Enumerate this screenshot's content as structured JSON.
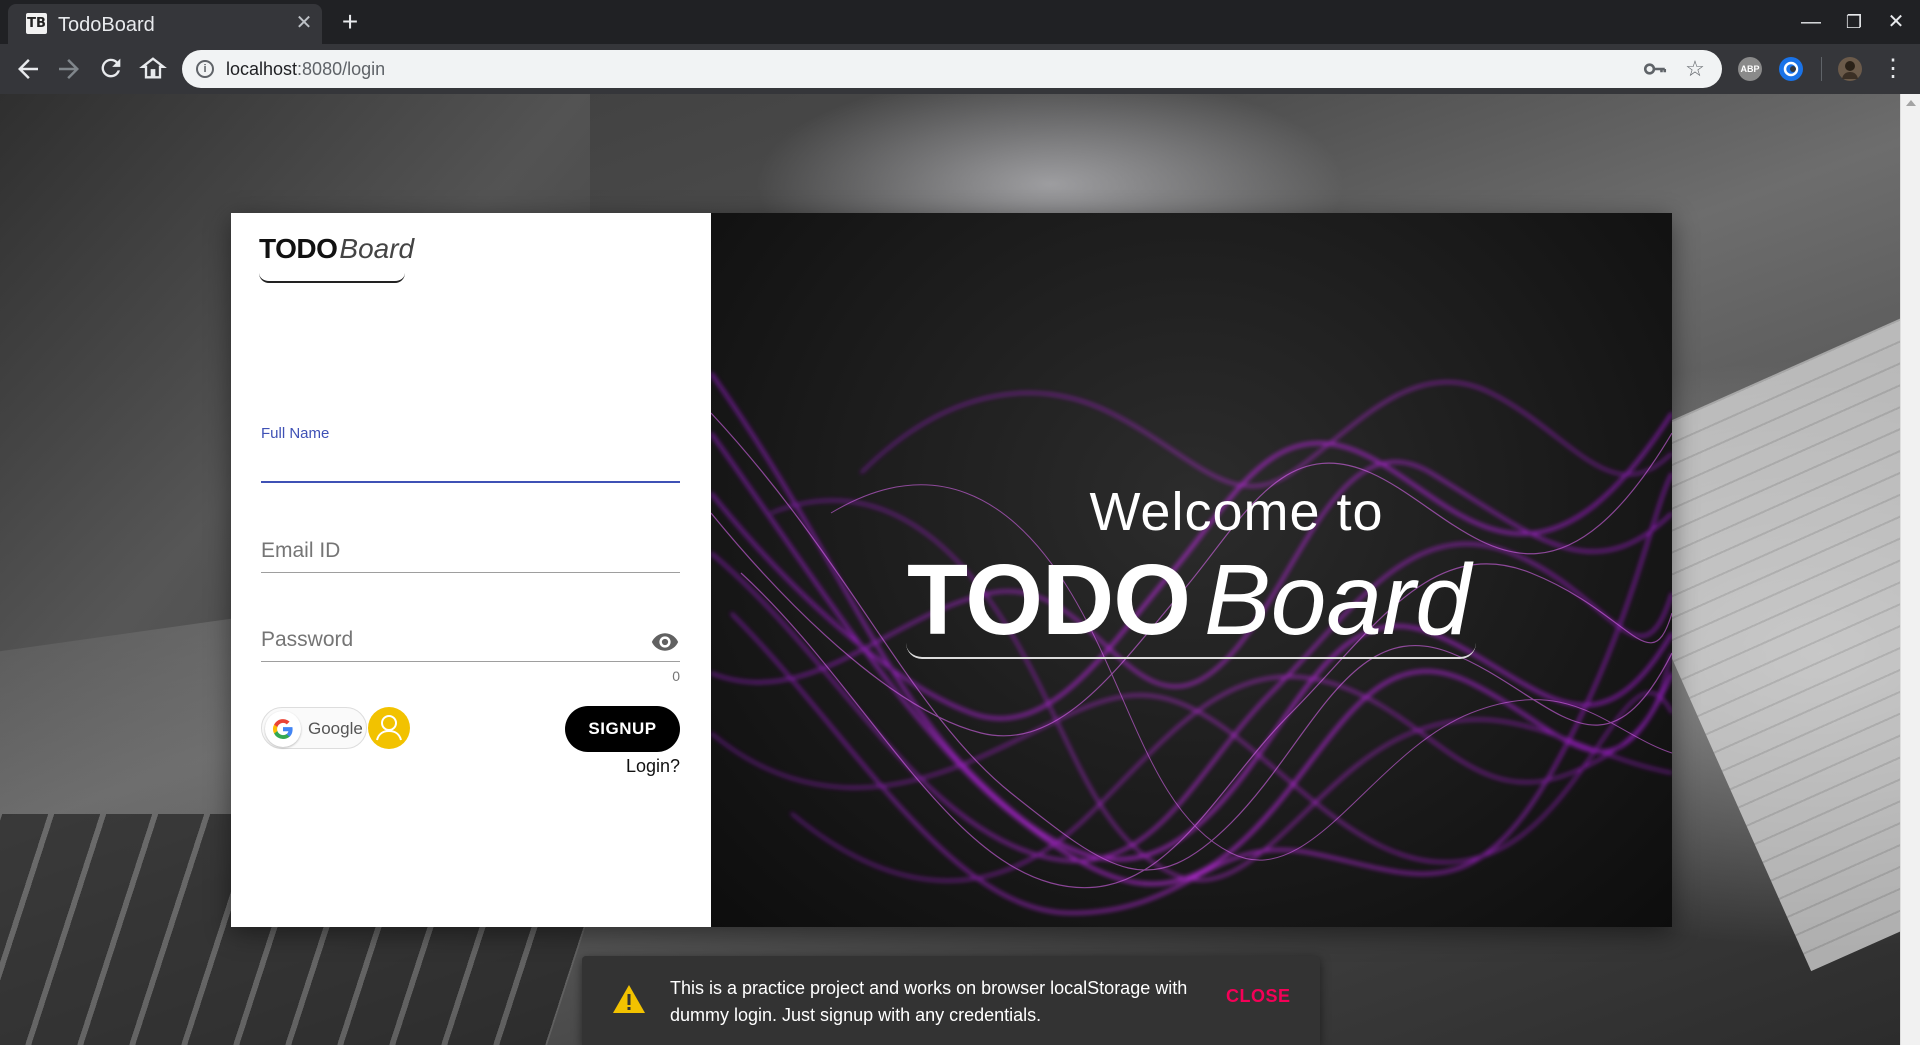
{
  "browser": {
    "tab_title": "TodoBoard",
    "favicon_text": "TB",
    "url_host": "localhost",
    "url_rest": ":8080/login",
    "extension_abp": "ABP"
  },
  "logo": {
    "todo": "TODO",
    "board": "Board"
  },
  "form": {
    "full_name_label": "Full Name",
    "full_name_value": "",
    "email_placeholder": "Email ID",
    "password_placeholder": "Password",
    "password_counter": "0",
    "google_label": "Google",
    "signup_label": "SIGNUP",
    "login_link": "Login?"
  },
  "hero": {
    "welcome": "Welcome to",
    "todo": "TODO",
    "board": "Board"
  },
  "snackbar": {
    "message": "This is a practice project and works on browser localStorage with dummy login. Just signup with any credentials.",
    "close_label": "CLOSE"
  },
  "colors": {
    "accent_blue": "#3f51b5",
    "signup_bg": "#000000",
    "guest_yellow": "#f2c200",
    "close_pink": "#f50057",
    "warning_yellow": "#f2c200",
    "hero_purple": "#b020e0"
  },
  "icons": {
    "back": "arrow-left-icon",
    "forward": "arrow-right-icon",
    "reload": "reload-icon",
    "home": "home-icon",
    "info": "info-icon",
    "key": "key-icon",
    "bookmark": "star-icon",
    "eye": "eye-icon",
    "warning": "warning-icon",
    "guest": "user-icon",
    "google": "google-g-icon"
  }
}
